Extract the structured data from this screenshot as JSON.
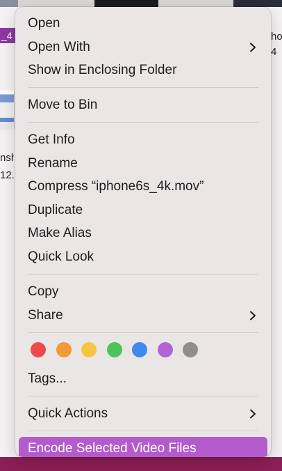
{
  "background": {
    "left_tag_text": "_4",
    "left_texts": [
      "nsh",
      "12."
    ],
    "right_texts": [
      "ho",
      "4"
    ]
  },
  "menu": {
    "items": [
      {
        "label": "Open"
      },
      {
        "label": "Open With",
        "submenu": true
      },
      {
        "label": "Show in Enclosing Folder"
      },
      {
        "label": "Move to Bin"
      },
      {
        "label": "Get Info"
      },
      {
        "label": "Rename"
      },
      {
        "label": "Compress “iphone6s_4k.mov”"
      },
      {
        "label": "Duplicate"
      },
      {
        "label": "Make Alias"
      },
      {
        "label": "Quick Look"
      },
      {
        "label": "Copy"
      },
      {
        "label": "Share",
        "submenu": true
      },
      {
        "label": "Tags..."
      },
      {
        "label": "Quick Actions",
        "submenu": true
      },
      {
        "label": "Encode Selected Video Files",
        "highlighted": true
      }
    ],
    "tag_colors": [
      {
        "name": "red",
        "color": "#ec4b4b"
      },
      {
        "name": "orange",
        "color": "#f09a3a"
      },
      {
        "name": "yellow",
        "color": "#f5c542"
      },
      {
        "name": "green",
        "color": "#4cc45a"
      },
      {
        "name": "blue",
        "color": "#3d8bf0"
      },
      {
        "name": "purple",
        "color": "#b065d2"
      },
      {
        "name": "gray",
        "color": "#8e8e8e"
      }
    ],
    "highlight_color": "#b35bcc"
  }
}
